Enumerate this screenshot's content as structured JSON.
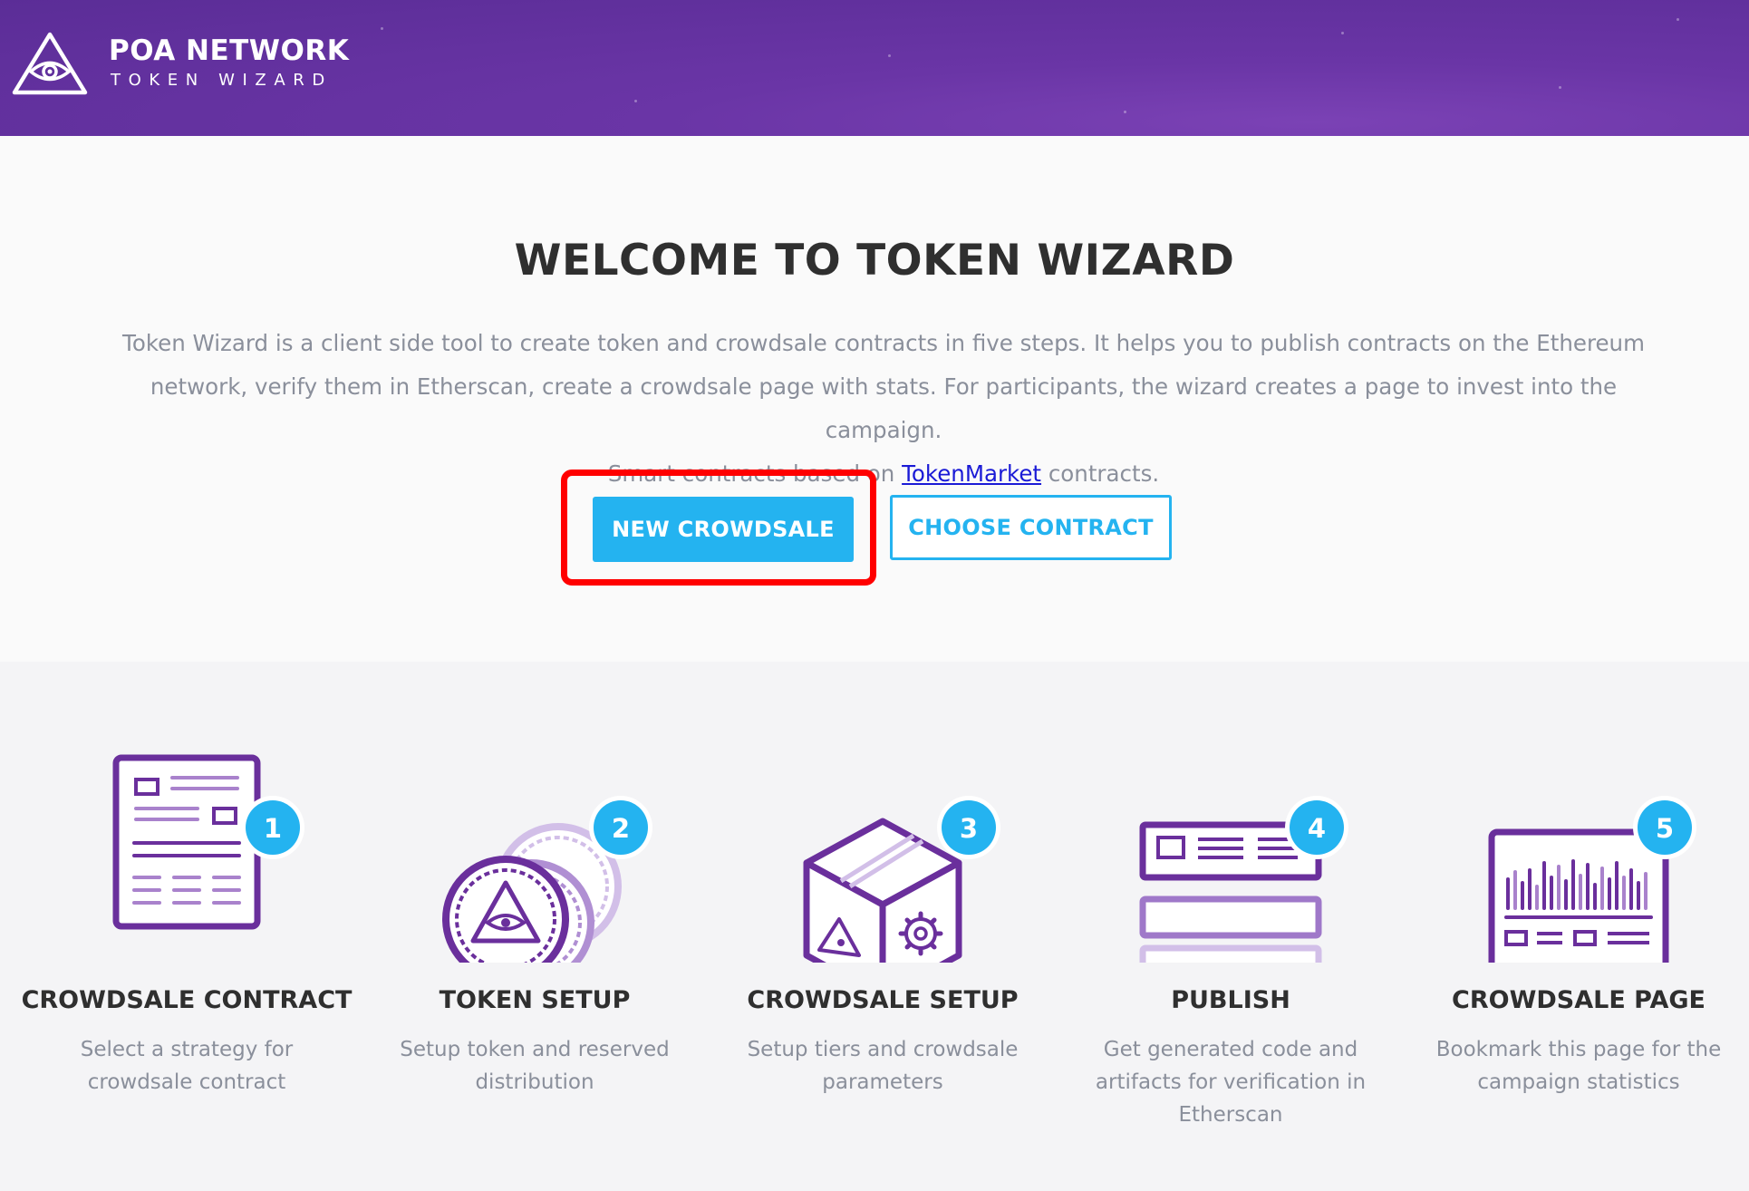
{
  "header": {
    "brand_name": "POA NETWORK",
    "brand_sub": "TOKEN WIZARD",
    "logo_icon": "poa-eye-triangle-icon"
  },
  "welcome": {
    "title": "WELCOME TO TOKEN WIZARD",
    "desc_line1": "Token Wizard is a client side tool to create token and crowdsale contracts in five steps. It helps you to publish contracts on the Ethereum",
    "desc_line2": "network, verify them in Etherscan, create a crowdsale page with stats. For participants, the wizard creates a page to invest into the campaign.",
    "desc_line3_pre": "Smart contracts based on ",
    "desc_link": "TokenMarket",
    "desc_line3_post": " contracts.",
    "new_crowdsale_label": "NEW CROWDSALE",
    "choose_contract_label": "CHOOSE CONTRACT"
  },
  "steps": [
    {
      "number": "1",
      "title": "CROWDSALE CONTRACT",
      "desc": "Select a strategy for crowdsale contract",
      "icon": "document-icon"
    },
    {
      "number": "2",
      "title": "TOKEN SETUP",
      "desc": "Setup token and reserved distribution",
      "icon": "coins-icon"
    },
    {
      "number": "3",
      "title": "CROWDSALE SETUP",
      "desc": "Setup tiers and crowdsale parameters",
      "icon": "box-icon"
    },
    {
      "number": "4",
      "title": "PUBLISH",
      "desc": "Get generated code and artifacts for verification in Etherscan",
      "icon": "publish-icon"
    },
    {
      "number": "5",
      "title": "CROWDSALE PAGE",
      "desc": "Bookmark this page for the campaign statistics",
      "icon": "page-stats-icon"
    }
  ],
  "colors": {
    "header_purple": "#6a35a6",
    "accent_blue": "#24b3f0",
    "icon_purple": "#6a2f9c",
    "highlight_red": "#ff0000"
  }
}
